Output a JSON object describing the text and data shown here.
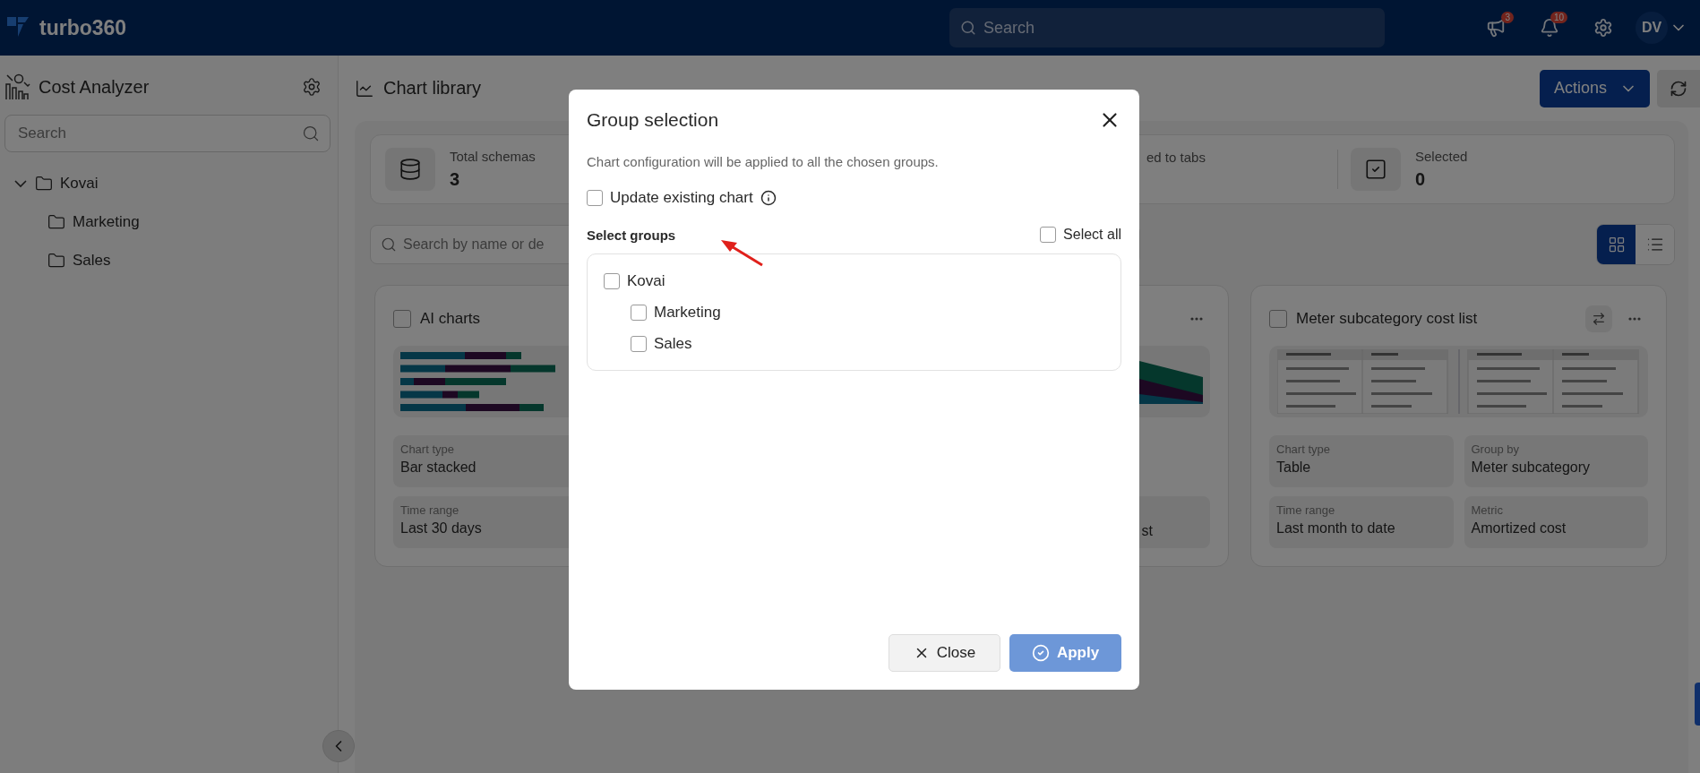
{
  "header": {
    "logo_text": "turbo360",
    "search": {
      "placeholder": "Search"
    },
    "alerts": [
      {
        "kind": "megaphone",
        "count": "3"
      },
      {
        "kind": "bell",
        "count": "10"
      }
    ],
    "avatar": "DV"
  },
  "sidebar": {
    "title": "Cost Analyzer",
    "search": {
      "placeholder": "Search"
    },
    "tree": [
      {
        "label": "Kovai",
        "expanded": true,
        "children": [
          {
            "label": "Marketing"
          },
          {
            "label": "Sales"
          }
        ]
      }
    ]
  },
  "main": {
    "title": "Chart library",
    "actions_button": "Actions",
    "stats": [
      {
        "kind": "schemas",
        "label": "Total schemas",
        "value": "3"
      },
      {
        "kind": "covered",
        "label": "ed to tabs"
      },
      {
        "kind": "selected",
        "label": "Selected",
        "value": "0"
      }
    ],
    "search": {
      "placeholder": "Search by name or de"
    },
    "view_modes": [
      {
        "kind": "grid",
        "selected": true
      },
      {
        "kind": "list",
        "selected": false
      }
    ],
    "cards": [
      {
        "kind": "bar",
        "title": "AI charts",
        "checked": false,
        "swap": false,
        "menu": false,
        "details": [
          {
            "kind": "topleft",
            "label": "Chart type",
            "value": "Bar stacked"
          },
          {
            "kind": "bottomleft",
            "label": "Time range",
            "value": "Last 30 days"
          }
        ]
      },
      {
        "kind": "area",
        "swap": false,
        "menu": true,
        "details": [
          {
            "kind": "bottomright",
            "value": "st"
          }
        ]
      },
      {
        "kind": "table",
        "title": "Meter subcategory cost list",
        "checked": false,
        "swap": true,
        "menu": true,
        "details": [
          {
            "kind": "topleft",
            "label": "Chart type",
            "value": "Table"
          },
          {
            "kind": "topright",
            "label": "Group by",
            "value": "Meter subcategory"
          },
          {
            "kind": "bottomleft",
            "label": "Time range",
            "value": "Last month to date"
          },
          {
            "kind": "bottomright",
            "label": "Metric",
            "value": "Amortized cost"
          }
        ]
      }
    ]
  },
  "dialog": {
    "title": "Group selection",
    "description": "Chart configuration will be applied to all the chosen groups.",
    "update_existing": {
      "label": "Update existing chart",
      "checked": false
    },
    "groups_label": "Select groups",
    "select_all": {
      "label": "Select all",
      "checked": false
    },
    "groups": [
      {
        "label": "Kovai",
        "checked": false,
        "children": [
          {
            "label": "Marketing",
            "checked": false
          },
          {
            "label": "Sales",
            "checked": false
          }
        ]
      }
    ],
    "buttons": [
      {
        "kind": "close",
        "label": "Close"
      },
      {
        "kind": "apply",
        "label": "Apply"
      }
    ]
  }
}
